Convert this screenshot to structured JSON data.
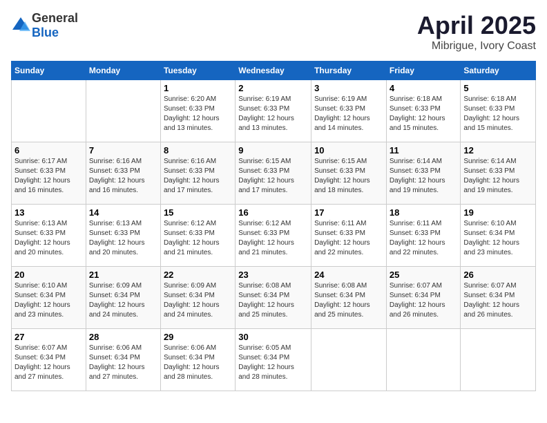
{
  "header": {
    "logo_general": "General",
    "logo_blue": "Blue",
    "title": "April 2025",
    "location": "Mibrigue, Ivory Coast"
  },
  "weekdays": [
    "Sunday",
    "Monday",
    "Tuesday",
    "Wednesday",
    "Thursday",
    "Friday",
    "Saturday"
  ],
  "weeks": [
    [
      {
        "day": "",
        "info": ""
      },
      {
        "day": "",
        "info": ""
      },
      {
        "day": "1",
        "info": "Sunrise: 6:20 AM\nSunset: 6:33 PM\nDaylight: 12 hours\nand 13 minutes."
      },
      {
        "day": "2",
        "info": "Sunrise: 6:19 AM\nSunset: 6:33 PM\nDaylight: 12 hours\nand 13 minutes."
      },
      {
        "day": "3",
        "info": "Sunrise: 6:19 AM\nSunset: 6:33 PM\nDaylight: 12 hours\nand 14 minutes."
      },
      {
        "day": "4",
        "info": "Sunrise: 6:18 AM\nSunset: 6:33 PM\nDaylight: 12 hours\nand 15 minutes."
      },
      {
        "day": "5",
        "info": "Sunrise: 6:18 AM\nSunset: 6:33 PM\nDaylight: 12 hours\nand 15 minutes."
      }
    ],
    [
      {
        "day": "6",
        "info": "Sunrise: 6:17 AM\nSunset: 6:33 PM\nDaylight: 12 hours\nand 16 minutes."
      },
      {
        "day": "7",
        "info": "Sunrise: 6:16 AM\nSunset: 6:33 PM\nDaylight: 12 hours\nand 16 minutes."
      },
      {
        "day": "8",
        "info": "Sunrise: 6:16 AM\nSunset: 6:33 PM\nDaylight: 12 hours\nand 17 minutes."
      },
      {
        "day": "9",
        "info": "Sunrise: 6:15 AM\nSunset: 6:33 PM\nDaylight: 12 hours\nand 17 minutes."
      },
      {
        "day": "10",
        "info": "Sunrise: 6:15 AM\nSunset: 6:33 PM\nDaylight: 12 hours\nand 18 minutes."
      },
      {
        "day": "11",
        "info": "Sunrise: 6:14 AM\nSunset: 6:33 PM\nDaylight: 12 hours\nand 19 minutes."
      },
      {
        "day": "12",
        "info": "Sunrise: 6:14 AM\nSunset: 6:33 PM\nDaylight: 12 hours\nand 19 minutes."
      }
    ],
    [
      {
        "day": "13",
        "info": "Sunrise: 6:13 AM\nSunset: 6:33 PM\nDaylight: 12 hours\nand 20 minutes."
      },
      {
        "day": "14",
        "info": "Sunrise: 6:13 AM\nSunset: 6:33 PM\nDaylight: 12 hours\nand 20 minutes."
      },
      {
        "day": "15",
        "info": "Sunrise: 6:12 AM\nSunset: 6:33 PM\nDaylight: 12 hours\nand 21 minutes."
      },
      {
        "day": "16",
        "info": "Sunrise: 6:12 AM\nSunset: 6:33 PM\nDaylight: 12 hours\nand 21 minutes."
      },
      {
        "day": "17",
        "info": "Sunrise: 6:11 AM\nSunset: 6:33 PM\nDaylight: 12 hours\nand 22 minutes."
      },
      {
        "day": "18",
        "info": "Sunrise: 6:11 AM\nSunset: 6:33 PM\nDaylight: 12 hours\nand 22 minutes."
      },
      {
        "day": "19",
        "info": "Sunrise: 6:10 AM\nSunset: 6:34 PM\nDaylight: 12 hours\nand 23 minutes."
      }
    ],
    [
      {
        "day": "20",
        "info": "Sunrise: 6:10 AM\nSunset: 6:34 PM\nDaylight: 12 hours\nand 23 minutes."
      },
      {
        "day": "21",
        "info": "Sunrise: 6:09 AM\nSunset: 6:34 PM\nDaylight: 12 hours\nand 24 minutes."
      },
      {
        "day": "22",
        "info": "Sunrise: 6:09 AM\nSunset: 6:34 PM\nDaylight: 12 hours\nand 24 minutes."
      },
      {
        "day": "23",
        "info": "Sunrise: 6:08 AM\nSunset: 6:34 PM\nDaylight: 12 hours\nand 25 minutes."
      },
      {
        "day": "24",
        "info": "Sunrise: 6:08 AM\nSunset: 6:34 PM\nDaylight: 12 hours\nand 25 minutes."
      },
      {
        "day": "25",
        "info": "Sunrise: 6:07 AM\nSunset: 6:34 PM\nDaylight: 12 hours\nand 26 minutes."
      },
      {
        "day": "26",
        "info": "Sunrise: 6:07 AM\nSunset: 6:34 PM\nDaylight: 12 hours\nand 26 minutes."
      }
    ],
    [
      {
        "day": "27",
        "info": "Sunrise: 6:07 AM\nSunset: 6:34 PM\nDaylight: 12 hours\nand 27 minutes."
      },
      {
        "day": "28",
        "info": "Sunrise: 6:06 AM\nSunset: 6:34 PM\nDaylight: 12 hours\nand 27 minutes."
      },
      {
        "day": "29",
        "info": "Sunrise: 6:06 AM\nSunset: 6:34 PM\nDaylight: 12 hours\nand 28 minutes."
      },
      {
        "day": "30",
        "info": "Sunrise: 6:05 AM\nSunset: 6:34 PM\nDaylight: 12 hours\nand 28 minutes."
      },
      {
        "day": "",
        "info": ""
      },
      {
        "day": "",
        "info": ""
      },
      {
        "day": "",
        "info": ""
      }
    ]
  ]
}
